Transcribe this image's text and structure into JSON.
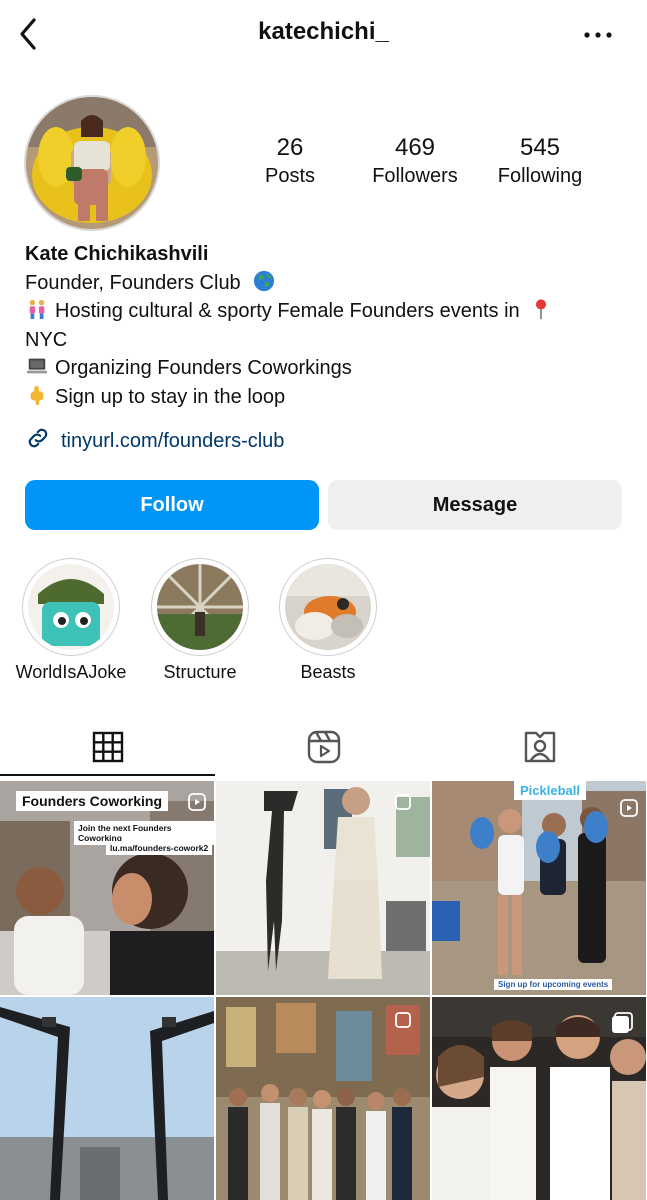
{
  "header": {
    "username": "katechichi_"
  },
  "profile": {
    "stats": [
      {
        "number": "26",
        "label": "Posts"
      },
      {
        "number": "469",
        "label": "Followers"
      },
      {
        "number": "545",
        "label": "Following"
      }
    ],
    "name": "Kate Chichikashvili",
    "bio_line1": "Founder, Founders Club",
    "bio_line2a": "Hosting cultural & sporty Female Founders events in",
    "bio_line2b": "NYC",
    "bio_line3": "Organizing Founders Coworkings",
    "bio_line4": "Sign up to stay in the loop",
    "link": "tinyurl.com/founders-club"
  },
  "buttons": {
    "follow": "Follow",
    "message": "Message"
  },
  "highlights": [
    {
      "label": "WorldIsAJoke"
    },
    {
      "label": "Structure"
    },
    {
      "label": "Beasts"
    }
  ],
  "tabs": [
    {
      "icon": "grid-icon"
    },
    {
      "icon": "reels-icon"
    },
    {
      "icon": "tagged-icon"
    }
  ],
  "posts": {
    "p1_title": "Founders Coworking",
    "p1_sub1": "Join the next Founders Coworking",
    "p1_sub2": "lu.ma/founders-cowork2",
    "p3_title": "Pickleball",
    "p3_caption": "Sign up for upcoming events"
  },
  "colors": {
    "accent": "#0095f6",
    "link": "#00376b",
    "secondary_button": "#efefef"
  }
}
